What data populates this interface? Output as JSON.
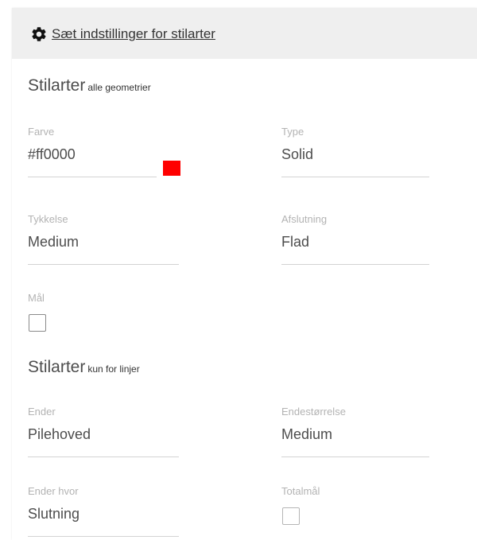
{
  "header": {
    "icon": "gear-icon",
    "label": "Sæt indstillinger for stilarter"
  },
  "section_all": {
    "title": "Stilarter",
    "subtitle": "alle geometrier"
  },
  "fields_all": {
    "farve": {
      "label": "Farve",
      "value": "#ff0000",
      "swatch_color": "#ff0000"
    },
    "type": {
      "label": "Type",
      "value": "Solid"
    },
    "tykkelse": {
      "label": "Tykkelse",
      "value": "Medium"
    },
    "afslutning": {
      "label": "Afslutning",
      "value": "Flad"
    },
    "maal": {
      "label": "Mål",
      "checked": false
    }
  },
  "section_lines": {
    "title": "Stilarter",
    "subtitle": "kun for linjer"
  },
  "fields_lines": {
    "ender": {
      "label": "Ender",
      "value": "Pilehoved"
    },
    "endestoerrelse": {
      "label": "Endestørrelse",
      "value": "Medium"
    },
    "ender_hvor": {
      "label": "Ender hvor",
      "value": "Slutning"
    },
    "totalmaal": {
      "label": "Totalmål",
      "checked": false
    }
  }
}
